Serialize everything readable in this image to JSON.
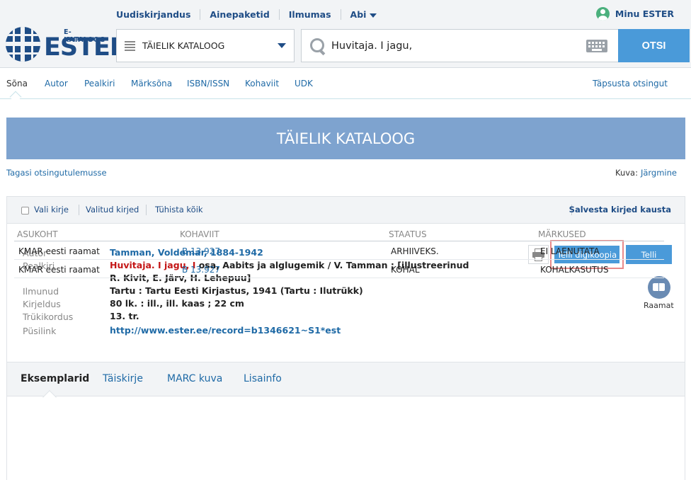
{
  "header": {
    "nav": [
      "Uudiskirjandus",
      "Ainepaketid",
      "Ilmumas",
      "Abi"
    ],
    "user": "Minu ESTER",
    "logo_small": "E-KATALOOG",
    "logo_big": "ESTER"
  },
  "search": {
    "catalog": "TÄIELIK KATALOOG",
    "query": "Huvitaja. I jagu,",
    "button": "OTSI"
  },
  "search_tabs": [
    "Sõna",
    "Autor",
    "Pealkiri",
    "Märksõna",
    "ISBN/ISSN",
    "Kohaviit",
    "UDK"
  ],
  "refine": "Täpsusta otsingut",
  "banner": "TÄIELIK KATALOOG",
  "back_link": "Tagasi otsingutulemusse",
  "paging": {
    "label": "Kuva:",
    "next": "Järgmine"
  },
  "toolbar": {
    "select": "Vali kirje",
    "selected": "Valitud kirjed",
    "clear": "Tühista kõik",
    "save": "Salvesta kirjed kausta"
  },
  "record": {
    "labels": [
      "Autor",
      "Pealkiri",
      "Ilmunud",
      "Kirjeldus",
      "Trükikordus",
      "Püsilink"
    ],
    "author": "Tamman, Voldemar, 1884-1942",
    "title_highlight": "Huvitaja. I jagu, I",
    "title_rest": " osa, Aabits ja alglugemik / V. Tamman ; [illustreerinud",
    "title_line2": "R. Kivit, E. Järv, H. Lehepuu]",
    "published": "Tartu : Tartu Eesti Kirjastus, 1941 (Tartu : Ilutrükk)",
    "description": "80 lk. : ill., ill. kaas ; 22 cm",
    "edition": "13. tr.",
    "permalink": "http://www.ester.ee/record=b1346621~S1*est"
  },
  "actions": {
    "digicopy": "Telli digikoopia",
    "order": "Telli",
    "material_type": "Raamat"
  },
  "detail_tabs": [
    "Eksemplarid",
    "Täiskirje",
    "MARC kuva",
    "Lisainfo"
  ],
  "holdings": {
    "columns": [
      "ASUKOHT",
      "KOHAVIIT",
      "STAATUS",
      "MÄRKUSED"
    ],
    "rows": [
      [
        "KMAR eesti raamat",
        "B 13.927",
        "ARHIIVEKS.",
        "EI LAENUTATA"
      ],
      [
        "KMAR eesti raamat",
        "B 13.927",
        "KOHAL",
        "KOHALKASUTUS"
      ]
    ]
  }
}
